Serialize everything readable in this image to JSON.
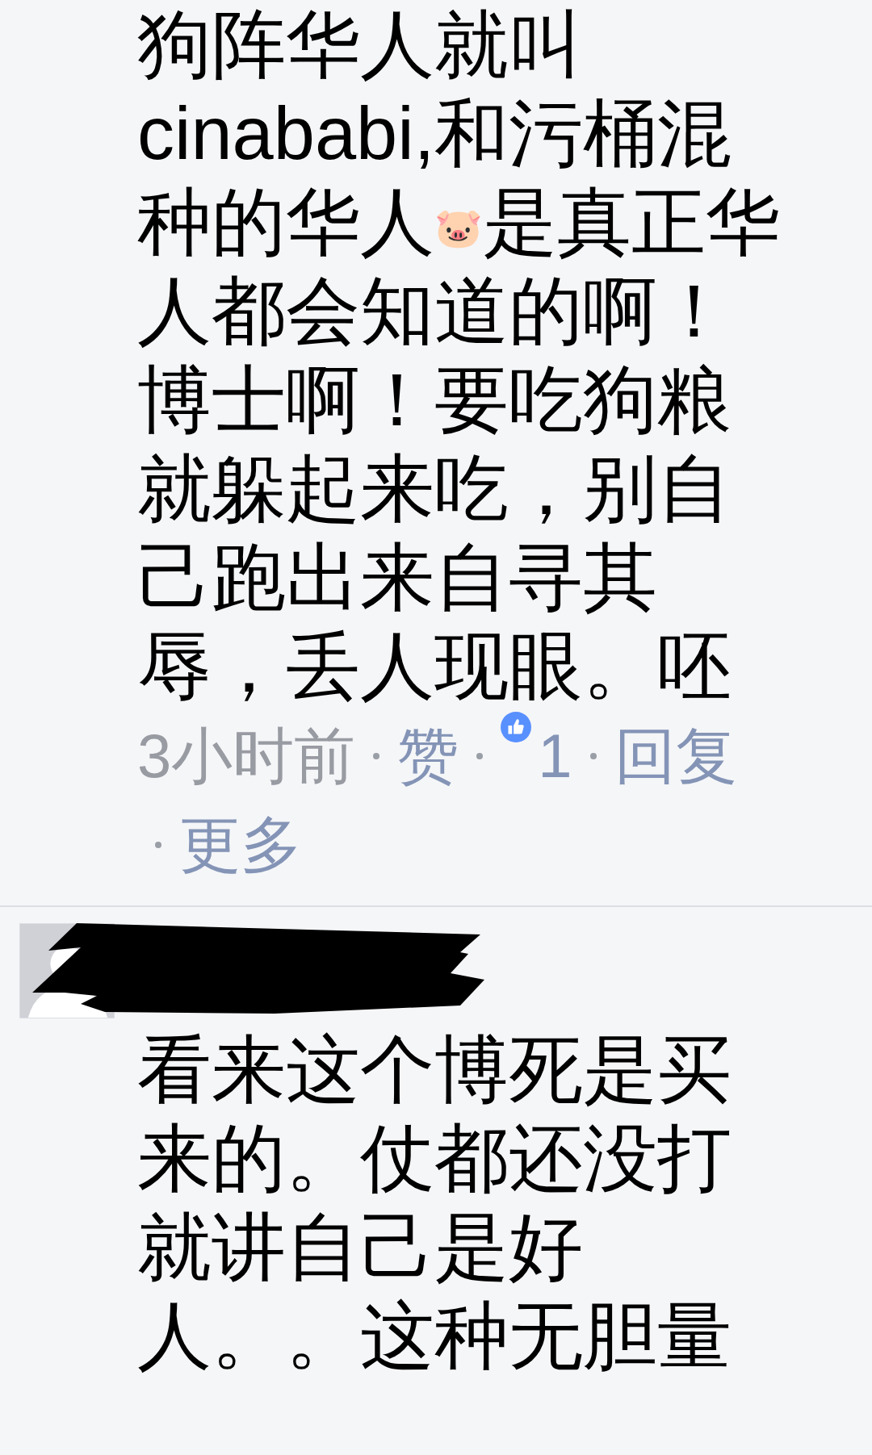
{
  "comments": [
    {
      "redacted": false,
      "text": "狗阵华人就叫cinababi,和污桶混种的华人🐷是真正华人都会知道的啊！博士啊！要吃狗粮就躲起来吃，别自己跑出来自寻其辱，丢人现眼。呸",
      "time": "3小时前",
      "actions": [
        {
          "kind": "link",
          "label": "赞"
        },
        {
          "kind": "reactions",
          "label": "1"
        },
        {
          "kind": "link",
          "label": "回复"
        },
        {
          "kind": "link",
          "label": "更多"
        }
      ]
    },
    {
      "redacted": true,
      "text": "看来这个博死是买来的。仗都还没打就讲自己是好人。。这种无胆量"
    }
  ]
}
